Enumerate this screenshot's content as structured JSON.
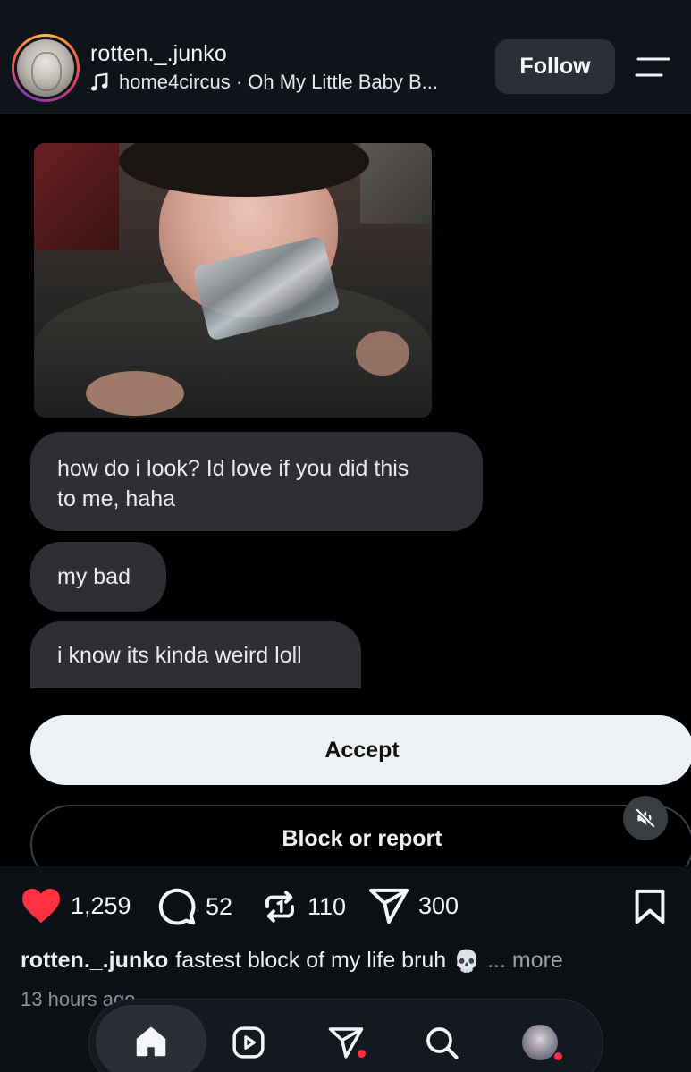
{
  "header": {
    "username": "rotten._.junko",
    "music": "home4circus · Oh My Little Baby B...",
    "follow_label": "Follow"
  },
  "reel": {
    "messages": [
      "how do i look? Id love if you did this\nto me, haha",
      "my bad",
      "i know its kinda weird loll"
    ],
    "accept_label": "Accept",
    "block_label": "Block or report"
  },
  "actions": {
    "likes": "1,259",
    "comments": "52",
    "reposts": "110",
    "shares": "300",
    "like_color": "#ff3040"
  },
  "caption": {
    "username": "rotten._.junko",
    "text": "fastest block of my life bruh",
    "emoji": "💀",
    "more": "... more",
    "timestamp": "13 hours ago"
  },
  "nav": {
    "items": [
      "home-icon",
      "reels-icon",
      "send-icon",
      "search-icon",
      "profile-avatar"
    ],
    "notification_color": "#ff3040"
  }
}
